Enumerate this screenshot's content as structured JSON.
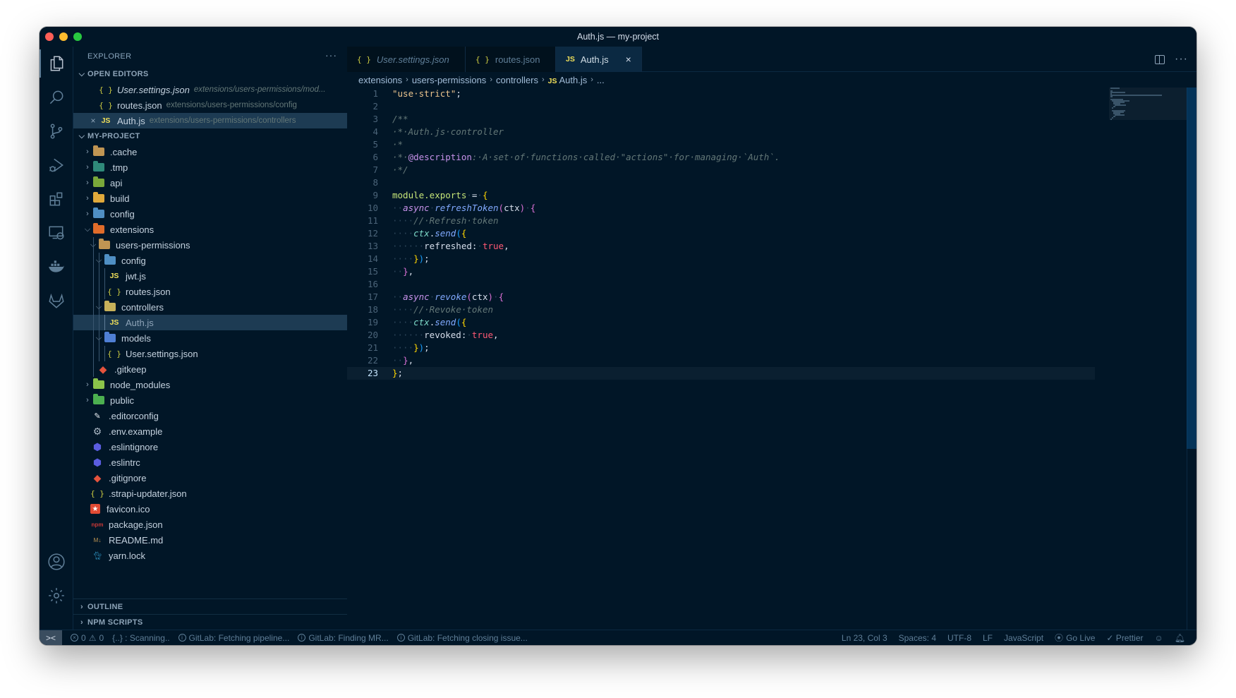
{
  "window": {
    "title": "Auth.js — my-project"
  },
  "activity_bar": {
    "items": [
      {
        "name": "explorer",
        "active": true
      },
      {
        "name": "search"
      },
      {
        "name": "source-control"
      },
      {
        "name": "run-and-debug"
      },
      {
        "name": "extensions"
      },
      {
        "name": "remote-explorer"
      },
      {
        "name": "docker"
      },
      {
        "name": "gitlab"
      }
    ],
    "bottom": [
      "accounts",
      "manage"
    ]
  },
  "sidebar": {
    "header": "EXPLORER",
    "more": "···",
    "open_editors": {
      "title": "OPEN EDITORS",
      "items": [
        {
          "icon": "json",
          "name": "User.settings.json",
          "path": "extensions/users-permissions/mod...",
          "italic": true
        },
        {
          "icon": "json",
          "name": "routes.json",
          "path": "extensions/users-permissions/config"
        },
        {
          "icon": "js",
          "name": "Auth.js",
          "path": "extensions/users-permissions/controllers",
          "active": true
        }
      ]
    },
    "project": {
      "title": "MY-PROJECT",
      "tree": [
        {
          "name": ".cache",
          "type": "folder",
          "depth": 0,
          "expanded": false,
          "color": "#c09553"
        },
        {
          "name": ".tmp",
          "type": "folder",
          "depth": 0,
          "expanded": false,
          "color": "#2f8a7a"
        },
        {
          "name": "api",
          "type": "folder",
          "depth": 0,
          "expanded": false,
          "color": "#7aa83a"
        },
        {
          "name": "build",
          "type": "folder",
          "depth": 0,
          "expanded": false,
          "color": "#e0a93b"
        },
        {
          "name": "config",
          "type": "folder",
          "depth": 0,
          "expanded": false,
          "color": "#4f8fc4"
        },
        {
          "name": "extensions",
          "type": "folder",
          "depth": 0,
          "expanded": true,
          "color": "#e06c2a"
        },
        {
          "name": "users-permissions",
          "type": "folder",
          "depth": 1,
          "expanded": true,
          "color": "#c09553"
        },
        {
          "name": "config",
          "type": "folder",
          "depth": 2,
          "expanded": true,
          "color": "#4f8fc4"
        },
        {
          "name": "jwt.js",
          "type": "js",
          "depth": 3
        },
        {
          "name": "routes.json",
          "type": "json",
          "depth": 3
        },
        {
          "name": "controllers",
          "type": "folder",
          "depth": 2,
          "expanded": true,
          "color": "#c7b15a"
        },
        {
          "name": "Auth.js",
          "type": "js",
          "depth": 3,
          "selected": true
        },
        {
          "name": "models",
          "type": "folder",
          "depth": 2,
          "expanded": true,
          "color": "#4f7fd4"
        },
        {
          "name": "User.settings.json",
          "type": "json",
          "depth": 3
        },
        {
          "name": ".gitkeep",
          "type": "git",
          "depth": 1
        },
        {
          "name": "node_modules",
          "type": "folder",
          "depth": 0,
          "expanded": false,
          "color": "#8bc34a"
        },
        {
          "name": "public",
          "type": "folder",
          "depth": 0,
          "expanded": false,
          "color": "#4caf50"
        },
        {
          "name": ".editorconfig",
          "type": "editorconfig",
          "depth": 0
        },
        {
          "name": ".env.example",
          "type": "gear",
          "depth": 0
        },
        {
          "name": ".eslintignore",
          "type": "eslint",
          "depth": 0
        },
        {
          "name": ".eslintrc",
          "type": "eslint",
          "depth": 0
        },
        {
          "name": ".gitignore",
          "type": "git",
          "depth": 0
        },
        {
          "name": ".strapi-updater.json",
          "type": "json",
          "depth": 0
        },
        {
          "name": "favicon.ico",
          "type": "favicon",
          "depth": 0
        },
        {
          "name": "package.json",
          "type": "npm",
          "depth": 0
        },
        {
          "name": "README.md",
          "type": "markdown",
          "depth": 0
        },
        {
          "name": "yarn.lock",
          "type": "yarn",
          "depth": 0
        }
      ]
    },
    "bottom_sections": [
      "OUTLINE",
      "NPM SCRIPTS"
    ]
  },
  "tabs": [
    {
      "icon": "json",
      "label": "User.settings.json",
      "italic": true
    },
    {
      "icon": "json",
      "label": "routes.json"
    },
    {
      "icon": "js",
      "label": "Auth.js",
      "active": true,
      "close": "×"
    }
  ],
  "breadcrumb": [
    "extensions",
    "users-permissions",
    "controllers",
    "Auth.js",
    "..."
  ],
  "editor": {
    "current_line": 23,
    "lines": [
      [
        [
          "c-str",
          "\"use·strict\""
        ],
        [
          "c-punc",
          ";"
        ]
      ],
      [],
      [
        [
          "c-com",
          "/**"
        ]
      ],
      [
        [
          "c-com",
          "·*·Auth.js·controller"
        ]
      ],
      [
        [
          "c-com",
          "·*"
        ]
      ],
      [
        [
          "c-com",
          "·*·"
        ],
        [
          "c-tag",
          "@description"
        ],
        [
          "c-com",
          ":·A·set·of·functions·called·\"actions\"·for·managing·`Auth`."
        ]
      ],
      [
        [
          "c-com",
          "·*/"
        ]
      ],
      [],
      [
        [
          "c-mod",
          "module.exports"
        ],
        [
          "c-ws",
          "·"
        ],
        [
          "c-punc",
          "="
        ],
        [
          "c-ws",
          "·"
        ],
        [
          "c-brace1",
          "{"
        ]
      ],
      [
        [
          "c-ws",
          "··"
        ],
        [
          "c-kw",
          "async"
        ],
        [
          "c-ws",
          "·"
        ],
        [
          "c-fn",
          "refreshToken"
        ],
        [
          "c-brace2",
          "("
        ],
        [
          "c-plain",
          "ctx"
        ],
        [
          "c-brace2",
          ")"
        ],
        [
          "c-ws",
          "·"
        ],
        [
          "c-brace2",
          "{"
        ]
      ],
      [
        [
          "c-ws",
          "····"
        ],
        [
          "c-com",
          "//·Refresh·token"
        ]
      ],
      [
        [
          "c-ws",
          "····"
        ],
        [
          "c-var",
          "ctx"
        ],
        [
          "c-punc",
          "."
        ],
        [
          "c-fn",
          "send"
        ],
        [
          "c-brace3",
          "("
        ],
        [
          "c-brace1",
          "{"
        ]
      ],
      [
        [
          "c-ws",
          "······"
        ],
        [
          "c-plain",
          "refreshed:"
        ],
        [
          "c-ws",
          "·"
        ],
        [
          "c-bool",
          "true"
        ],
        [
          "c-punc",
          ","
        ]
      ],
      [
        [
          "c-ws",
          "····"
        ],
        [
          "c-brace1",
          "}"
        ],
        [
          "c-brace3",
          ")"
        ],
        [
          "c-punc",
          ";"
        ]
      ],
      [
        [
          "c-ws",
          "··"
        ],
        [
          "c-brace2",
          "}"
        ],
        [
          "c-punc",
          ","
        ]
      ],
      [],
      [
        [
          "c-ws",
          "··"
        ],
        [
          "c-kw",
          "async"
        ],
        [
          "c-ws",
          "·"
        ],
        [
          "c-fn",
          "revoke"
        ],
        [
          "c-brace2",
          "("
        ],
        [
          "c-plain",
          "ctx"
        ],
        [
          "c-brace2",
          ")"
        ],
        [
          "c-ws",
          "·"
        ],
        [
          "c-brace2",
          "{"
        ]
      ],
      [
        [
          "c-ws",
          "····"
        ],
        [
          "c-com",
          "//·Revoke·token"
        ]
      ],
      [
        [
          "c-ws",
          "····"
        ],
        [
          "c-var",
          "ctx"
        ],
        [
          "c-punc",
          "."
        ],
        [
          "c-fn",
          "send"
        ],
        [
          "c-brace3",
          "("
        ],
        [
          "c-brace1",
          "{"
        ]
      ],
      [
        [
          "c-ws",
          "······"
        ],
        [
          "c-plain",
          "revoked:"
        ],
        [
          "c-ws",
          "·"
        ],
        [
          "c-bool",
          "true"
        ],
        [
          "c-punc",
          ","
        ]
      ],
      [
        [
          "c-ws",
          "····"
        ],
        [
          "c-brace1",
          "}"
        ],
        [
          "c-brace3",
          ")"
        ],
        [
          "c-punc",
          ";"
        ]
      ],
      [
        [
          "c-ws",
          "··"
        ],
        [
          "c-brace2",
          "}"
        ],
        [
          "c-punc",
          ","
        ]
      ],
      [
        [
          "c-brace1",
          "}"
        ],
        [
          "c-punc",
          ";"
        ]
      ]
    ]
  },
  "statusbar": {
    "remote": "><",
    "errors": "0",
    "warnings": "0",
    "scanning": "{..} : Scanning..",
    "gitlab_items": [
      "GitLab: Fetching pipeline...",
      "GitLab: Finding MR...",
      "GitLab: Fetching closing issue..."
    ],
    "position": "Ln 23, Col 3",
    "spaces": "Spaces: 4",
    "encoding": "UTF-8",
    "eol": "LF",
    "language": "JavaScript",
    "go_live": "Go Live",
    "prettier": "✓ Prettier"
  }
}
